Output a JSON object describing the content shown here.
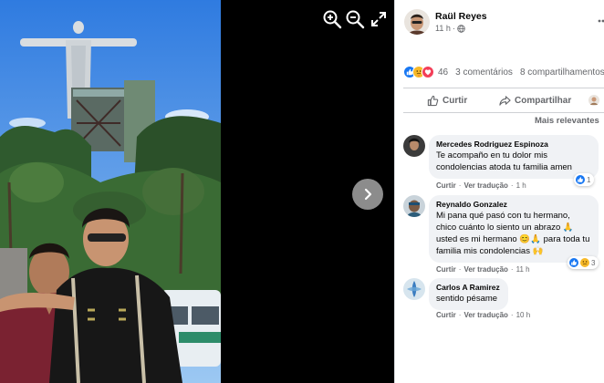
{
  "viewer": {
    "zoom_in_icon": "zoom-in-icon",
    "zoom_out_icon": "zoom-out-icon",
    "fullscreen_icon": "expand-icon",
    "next_icon": "chevron-right-icon"
  },
  "post": {
    "author": "Raül Reyes",
    "time": "11 h",
    "audience_icon": "globe-icon",
    "more_icon": "more-dots",
    "reaction_count": "46",
    "comments_count": "3 comentários",
    "shares_count": "8 compartilhamentos",
    "actions": {
      "like": "Curtir",
      "share": "Compartilhar"
    },
    "sort_label": "Mais relevantes"
  },
  "comments": [
    {
      "author": "Mercedes Rodriguez Espinoza",
      "text": "Te acompaño en tu dolor mis condolencias atoda tu familia amen",
      "like": "Curtir",
      "see_translation": "Ver tradução",
      "time": "1 h",
      "reaction_count": "1"
    },
    {
      "author": "Reynaldo Gonzalez",
      "text": "Mi pana qué pasó con tu hermano, chico cuánto lo siento un abrazo 🙏 usted es mi hermano 😊🙏 para toda tu familia mis condolencias 🙌",
      "like": "Curtir",
      "see_translation": "Ver tradução",
      "time": "11 h",
      "reaction_count": "3"
    },
    {
      "author": "Carlos A Ramirez",
      "text": "sentido pésame",
      "like": "Curtir",
      "see_translation": "Ver tradução",
      "time": "10 h"
    }
  ],
  "colors": {
    "like_blue": "#1877f2",
    "love_red": "#f33e58",
    "care_yellow": "#f7b928",
    "muted_text": "#65676b",
    "bubble_bg": "#f0f2f5"
  }
}
